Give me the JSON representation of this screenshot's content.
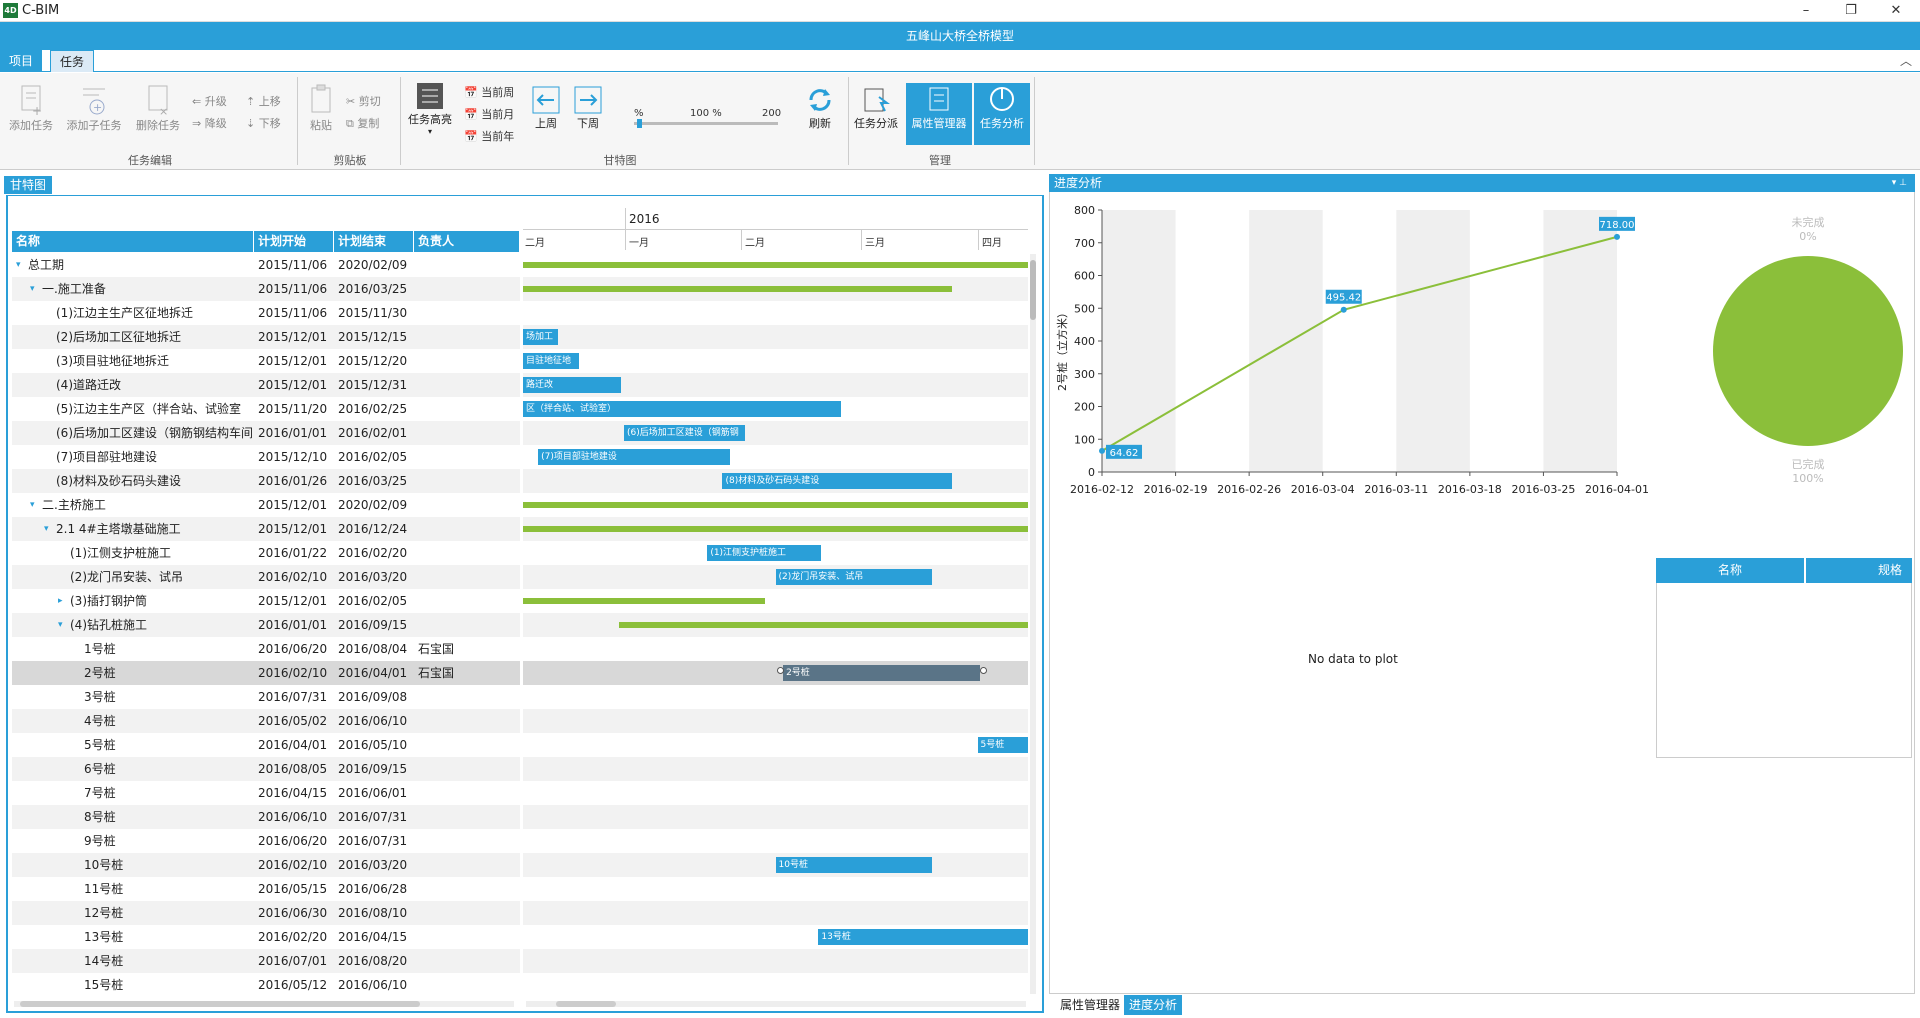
{
  "window": {
    "app_name": "C-BIM",
    "app_icon_text": "4D",
    "doc_title": "五峰山大桥全桥模型",
    "controls": {
      "minimize": "–",
      "maximize": "❐",
      "close": "✕"
    }
  },
  "ribbon_tabs": [
    "项目",
    "任务"
  ],
  "ribbon": {
    "edit": {
      "add_task": "添加任务",
      "add_child": "添加子任务",
      "delete_task": "删除任务",
      "promote": "升级",
      "demote": "降级",
      "move_up": "上移",
      "move_down": "下移",
      "caption": "任务编辑"
    },
    "clipboard": {
      "paste": "粘贴",
      "cut": "剪切",
      "copy": "复制",
      "caption": "剪贴板"
    },
    "gantt": {
      "highlight": "任务高亮",
      "cur_week": "当前周",
      "cur_month": "当前月",
      "cur_year": "当前年",
      "prev_week": "上周",
      "next_week": "下周",
      "zoom_min": "%",
      "zoom_val": "100 %",
      "zoom_max": "200",
      "zoom_fraction": 0.02,
      "refresh": "刷新",
      "caption": "甘特图"
    },
    "manage": {
      "dispatch": "任务分派",
      "prop_mgr": "属性管理器",
      "analysis": "任务分析",
      "caption": "管理"
    }
  },
  "gantt_panel": {
    "tab": "甘特图",
    "columns": [
      "名称",
      "计划开始",
      "计划结束",
      "负责人"
    ],
    "year": "2016",
    "months": [
      "二月",
      "一月",
      "二月",
      "三月",
      "四月"
    ],
    "rows": [
      {
        "name": "总工期",
        "start": "2015/11/06",
        "end": "2020/02/09",
        "owner": "",
        "lvl": 0,
        "exp": "▾",
        "bar": "",
        "kind": "sum",
        "s": 0,
        "e": 1
      },
      {
        "name": "一.施工准备",
        "start": "2015/11/06",
        "end": "2016/03/25",
        "owner": "",
        "lvl": 1,
        "exp": "▾",
        "bar": "",
        "kind": "sum",
        "s": 0,
        "e": 0.85
      },
      {
        "name": "(1)江边主生产区征地拆迁",
        "start": "2015/11/06",
        "end": "2015/11/30",
        "owner": "",
        "lvl": 2,
        "exp": "",
        "bar": "",
        "kind": "none",
        "s": 0,
        "e": 0
      },
      {
        "name": "(2)后场加工区征地拆迁",
        "start": "2015/12/01",
        "end": "2015/12/15",
        "owner": "",
        "lvl": 2,
        "exp": "",
        "bar": "场加工",
        "kind": "task",
        "s": 0,
        "e": 0.07
      },
      {
        "name": "(3)项目驻地征地拆迁",
        "start": "2015/12/01",
        "end": "2015/12/20",
        "owner": "",
        "lvl": 2,
        "exp": "",
        "bar": "目驻地征地",
        "kind": "task",
        "s": 0,
        "e": 0.11
      },
      {
        "name": "(4)道路迁改",
        "start": "2015/12/01",
        "end": "2015/12/31",
        "owner": "",
        "lvl": 2,
        "exp": "",
        "bar": "路迁改",
        "kind": "task",
        "s": 0,
        "e": 0.195
      },
      {
        "name": "(5)江边主生产区（拌合站、试验室",
        "start": "2015/11/20",
        "end": "2016/02/25",
        "owner": "",
        "lvl": 2,
        "exp": "",
        "bar": "区（拌合站、试验室）",
        "kind": "task",
        "s": 0,
        "e": 0.63
      },
      {
        "name": "(6)后场加工区建设（钢筋钢结构车间",
        "start": "2016/01/01",
        "end": "2016/02/01",
        "owner": "",
        "lvl": 2,
        "exp": "",
        "bar": "(6)后场加工区建设（钢筋钢",
        "kind": "task",
        "s": 0.2,
        "e": 0.44
      },
      {
        "name": "(7)项目部驻地建设",
        "start": "2015/12/10",
        "end": "2016/02/05",
        "owner": "",
        "lvl": 2,
        "exp": "",
        "bar": "(7)项目部驻地建设",
        "kind": "task",
        "s": 0.03,
        "e": 0.41
      },
      {
        "name": "(8)材料及砂石码头建设",
        "start": "2016/01/26",
        "end": "2016/03/25",
        "owner": "",
        "lvl": 2,
        "exp": "",
        "bar": "(8)材料及砂石码头建设",
        "kind": "task",
        "s": 0.395,
        "e": 0.85
      },
      {
        "name": "二.主桥施工",
        "start": "2015/12/01",
        "end": "2020/02/09",
        "owner": "",
        "lvl": 1,
        "exp": "▾",
        "bar": "",
        "kind": "sum",
        "s": 0,
        "e": 1
      },
      {
        "name": "2.1 4#主塔墩基础施工",
        "start": "2015/12/01",
        "end": "2016/12/24",
        "owner": "",
        "lvl": 2,
        "exp": "▾",
        "bar": "",
        "kind": "sum",
        "s": 0,
        "e": 1
      },
      {
        "name": "(1)江侧支护桩施工",
        "start": "2016/01/22",
        "end": "2016/02/20",
        "owner": "",
        "lvl": 3,
        "exp": "",
        "bar": "(1)江侧支护桩施工",
        "kind": "task",
        "s": 0.365,
        "e": 0.59
      },
      {
        "name": "(2)龙门吊安装、试吊",
        "start": "2016/02/10",
        "end": "2016/03/20",
        "owner": "",
        "lvl": 3,
        "exp": "",
        "bar": "(2)龙门吊安装、试吊",
        "kind": "task",
        "s": 0.5,
        "e": 0.81
      },
      {
        "name": "(3)插打钢护筒",
        "start": "2015/12/01",
        "end": "2016/02/05",
        "owner": "",
        "lvl": 3,
        "exp": "▸",
        "bar": "",
        "kind": "sum",
        "s": 0,
        "e": 0.48
      },
      {
        "name": "(4)钻孔桩施工",
        "start": "2016/01/01",
        "end": "2016/09/15",
        "owner": "",
        "lvl": 3,
        "exp": "▾",
        "bar": "",
        "kind": "sum",
        "s": 0.19,
        "e": 1
      },
      {
        "name": "1号桩",
        "start": "2016/06/20",
        "end": "2016/08/04",
        "owner": "石宝国",
        "lvl": 4,
        "exp": "",
        "bar": "",
        "kind": "none",
        "s": 0,
        "e": 0
      },
      {
        "name": "2号桩",
        "start": "2016/02/10",
        "end": "2016/04/01",
        "owner": "石宝国",
        "lvl": 4,
        "exp": "",
        "bar": "2号桩",
        "kind": "selbar",
        "s": 0.515,
        "e": 0.905
      },
      {
        "name": "3号桩",
        "start": "2016/07/31",
        "end": "2016/09/08",
        "owner": "",
        "lvl": 4,
        "exp": "",
        "bar": "",
        "kind": "none",
        "s": 0,
        "e": 0
      },
      {
        "name": "4号桩",
        "start": "2016/05/02",
        "end": "2016/06/10",
        "owner": "",
        "lvl": 4,
        "exp": "",
        "bar": "",
        "kind": "none",
        "s": 0,
        "e": 0
      },
      {
        "name": "5号桩",
        "start": "2016/04/01",
        "end": "2016/05/10",
        "owner": "",
        "lvl": 4,
        "exp": "",
        "bar": "5号桩",
        "kind": "task",
        "s": 0.9,
        "e": 1
      },
      {
        "name": "6号桩",
        "start": "2016/08/05",
        "end": "2016/09/15",
        "owner": "",
        "lvl": 4,
        "exp": "",
        "bar": "",
        "kind": "none",
        "s": 0,
        "e": 0
      },
      {
        "name": "7号桩",
        "start": "2016/04/15",
        "end": "2016/06/01",
        "owner": "",
        "lvl": 4,
        "exp": "",
        "bar": "",
        "kind": "none",
        "s": 0,
        "e": 0
      },
      {
        "name": "8号桩",
        "start": "2016/06/10",
        "end": "2016/07/31",
        "owner": "",
        "lvl": 4,
        "exp": "",
        "bar": "",
        "kind": "none",
        "s": 0,
        "e": 0
      },
      {
        "name": "9号桩",
        "start": "2016/06/20",
        "end": "2016/07/31",
        "owner": "",
        "lvl": 4,
        "exp": "",
        "bar": "",
        "kind": "none",
        "s": 0,
        "e": 0
      },
      {
        "name": "10号桩",
        "start": "2016/02/10",
        "end": "2016/03/20",
        "owner": "",
        "lvl": 4,
        "exp": "",
        "bar": "10号桩",
        "kind": "task",
        "s": 0.5,
        "e": 0.81
      },
      {
        "name": "11号桩",
        "start": "2016/05/15",
        "end": "2016/06/28",
        "owner": "",
        "lvl": 4,
        "exp": "",
        "bar": "",
        "kind": "none",
        "s": 0,
        "e": 0
      },
      {
        "name": "12号桩",
        "start": "2016/06/30",
        "end": "2016/08/10",
        "owner": "",
        "lvl": 4,
        "exp": "",
        "bar": "",
        "kind": "none",
        "s": 0,
        "e": 0
      },
      {
        "name": "13号桩",
        "start": "2016/02/20",
        "end": "2016/04/15",
        "owner": "",
        "lvl": 4,
        "exp": "",
        "bar": "13号桩",
        "kind": "task",
        "s": 0.585,
        "e": 1
      },
      {
        "name": "14号桩",
        "start": "2016/07/01",
        "end": "2016/08/20",
        "owner": "",
        "lvl": 4,
        "exp": "",
        "bar": "",
        "kind": "none",
        "s": 0,
        "e": 0
      },
      {
        "name": "15号桩",
        "start": "2016/05/12",
        "end": "2016/06/10",
        "owner": "",
        "lvl": 4,
        "exp": "",
        "bar": "",
        "kind": "none",
        "s": 0,
        "e": 0
      }
    ]
  },
  "analysis_panel": {
    "title": "进度分析",
    "pin": "▾ ⊥",
    "ylabel": "2号桩（立方米）",
    "yticks": [
      "800",
      "700",
      "600",
      "500",
      "400",
      "300",
      "200",
      "100",
      "0"
    ],
    "no_data": "No data to plot",
    "table_cols": [
      "名称",
      "规格"
    ],
    "pie": {
      "incomplete_label": "未完成",
      "incomplete_pct": "0%",
      "done_label": "已完成",
      "done_pct": "100%",
      "color": "#8bbf3a"
    },
    "bottom_tabs": [
      "属性管理器",
      "进度分析"
    ]
  },
  "chart_data": {
    "type": "line",
    "title": "",
    "xlabel": "",
    "ylabel": "2号桩（立方米）",
    "ylim": [
      0,
      800
    ],
    "x": [
      "2016-02-12",
      "2016-02-19",
      "2016-02-26",
      "2016-03-04",
      "2016-03-11",
      "2016-03-18",
      "2016-03-25",
      "2016-04-01"
    ],
    "series": [
      {
        "name": "",
        "points": [
          {
            "x": "2016-02-12",
            "y": 64.62
          },
          {
            "x": "2016-03-06",
            "y": 495.42
          },
          {
            "x": "2016-04-01",
            "y": 718.0
          }
        ],
        "labels": [
          "64.62",
          "495.42",
          "718.00"
        ],
        "color": "#8bbf3a"
      }
    ],
    "grid": true
  }
}
